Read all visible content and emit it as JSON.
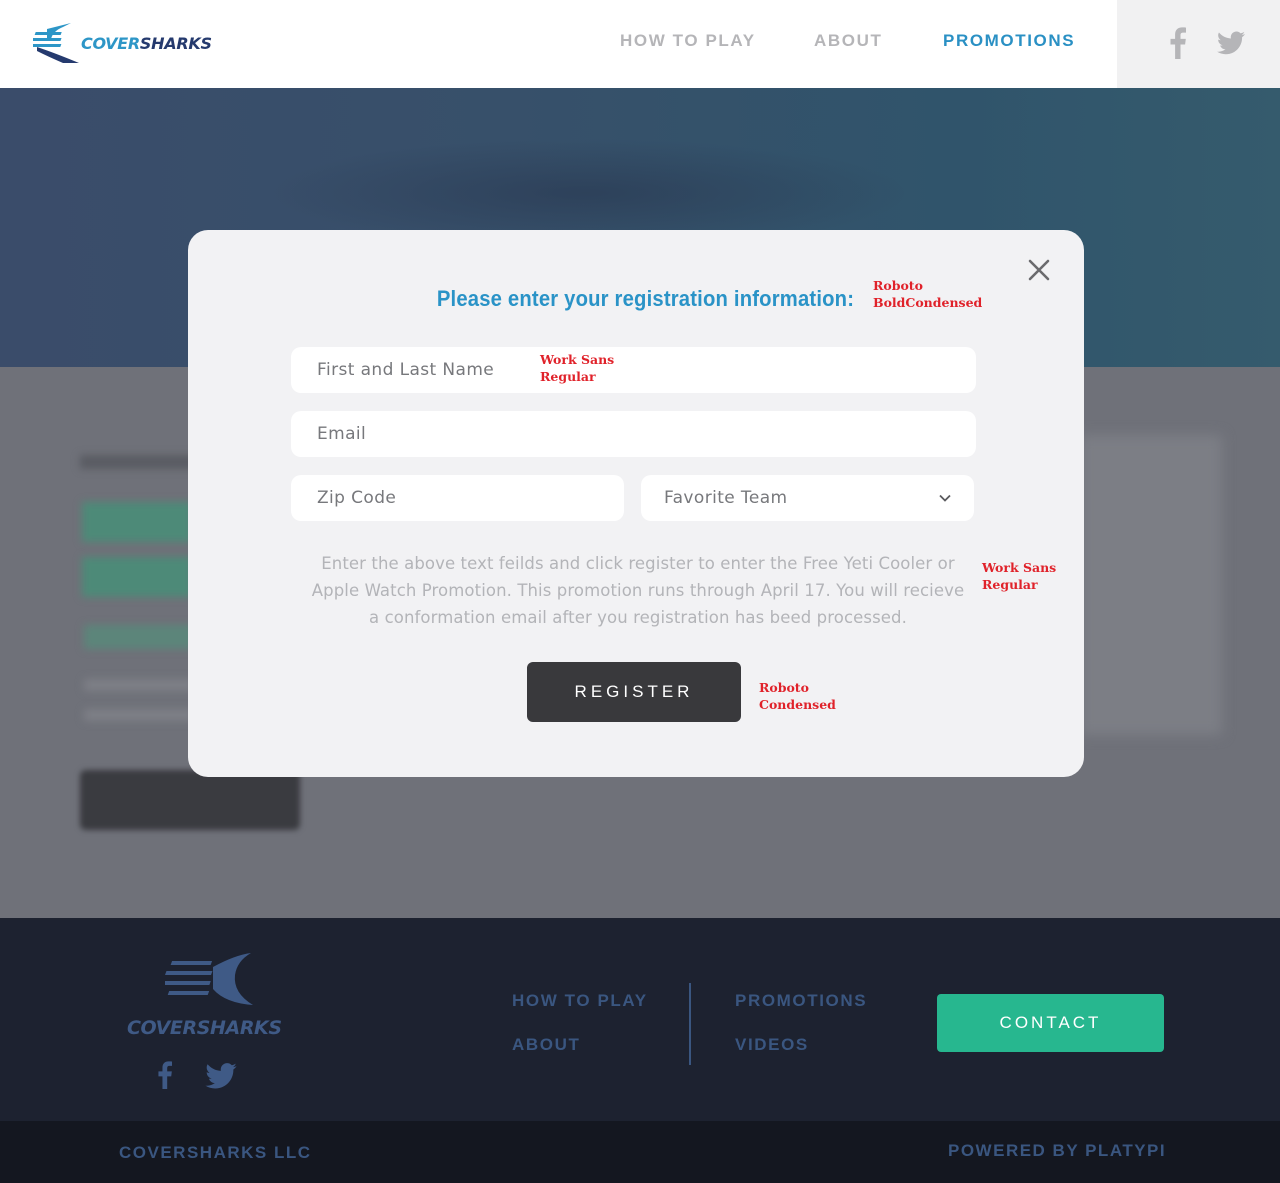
{
  "header": {
    "brand": {
      "part1": "COVER",
      "part2": "SHARKS"
    },
    "nav": [
      {
        "label": "HOW TO PLAY",
        "active": false
      },
      {
        "label": "ABOUT",
        "active": false
      },
      {
        "label": "PROMOTIONS",
        "active": true
      }
    ],
    "social": [
      "facebook-icon",
      "twitter-icon"
    ]
  },
  "modal": {
    "title": "Please enter your registration information:",
    "fields": {
      "name_placeholder": "First and Last Name",
      "email_placeholder": "Email",
      "zip_placeholder": "Zip Code",
      "team_selected": "Favorite Team"
    },
    "description": "Enter the above text feilds and click register to enter the Free Yeti Cooler or Apple Watch Promotion. This promotion runs through April 17. You will recieve a conformation email after you registration has beed processed.",
    "register_label": "REGISTER",
    "annotations": {
      "title_font": "Roboto\nBoldCondensed",
      "field_font": "Work Sans\nRegular",
      "desc_font": "Work Sans\nRegular",
      "button_font": "Roboto\nCondensed"
    }
  },
  "footer": {
    "brand": "COVERSHARKS",
    "nav_col1": [
      "HOW TO PLAY",
      "ABOUT"
    ],
    "nav_col2": [
      "PROMOTIONS",
      "VIDEOS"
    ],
    "contact_label": "CONTACT",
    "company": "COVERSHARKS LLC",
    "powered_by": "POWERED BY PLATYPI"
  },
  "colors": {
    "accent": "#2a93c7",
    "contact": "#27b78f",
    "footer_bg": "#1d2230",
    "annotation": "#e0222a"
  }
}
